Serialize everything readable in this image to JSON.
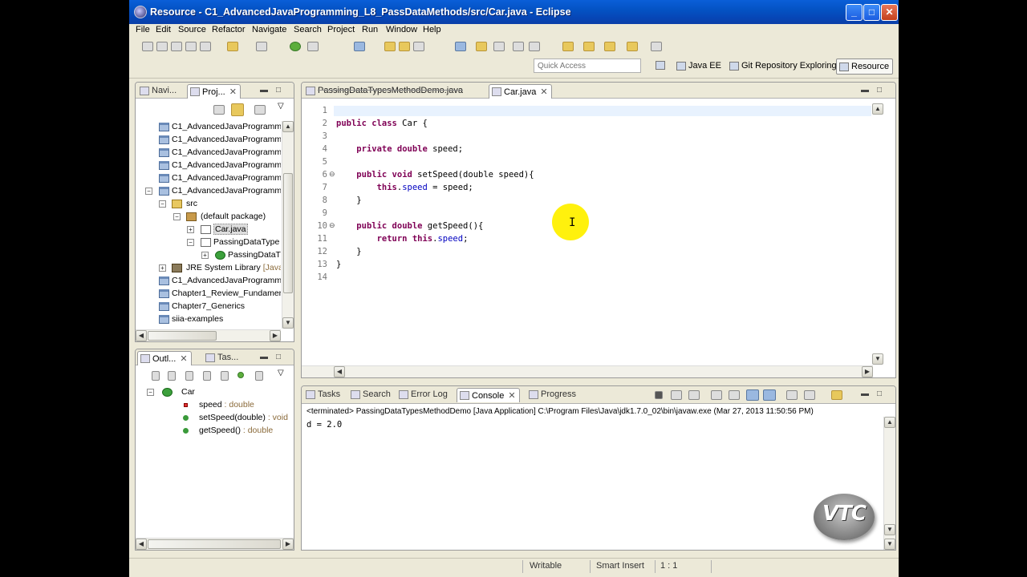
{
  "window": {
    "title": "Resource - C1_AdvancedJavaProgramming_L8_PassDataMethods/src/Car.java - Eclipse",
    "minimize": "_",
    "maximize": "□",
    "close": "✕"
  },
  "menu": [
    "File",
    "Edit",
    "Source",
    "Refactor",
    "Navigate",
    "Search",
    "Project",
    "Run",
    "Window",
    "Help"
  ],
  "toolbar": {
    "quick_access_placeholder": "Quick Access",
    "perspectives": [
      "Java EE",
      "Git Repository Exploring",
      "Resource"
    ],
    "active_perspective": "Resource"
  },
  "navigator": {
    "tabs": [
      "Navi...",
      "Proj...",
      "✕"
    ],
    "tree": [
      {
        "label": "C1_AdvancedJavaProgramm",
        "kind": "project"
      },
      {
        "label": "C1_AdvancedJavaProgramm",
        "kind": "project"
      },
      {
        "label": "C1_AdvancedJavaProgramm",
        "kind": "project"
      },
      {
        "label": "C1_AdvancedJavaProgramm",
        "kind": "project"
      },
      {
        "label": "C1_AdvancedJavaProgramm",
        "kind": "project"
      },
      {
        "label": "C1_AdvancedJavaProgramm",
        "kind": "project",
        "expanded": true
      },
      {
        "label": "src",
        "kind": "src"
      },
      {
        "label": "(default package)",
        "kind": "package"
      },
      {
        "label": "Car.java",
        "kind": "java",
        "selected": true
      },
      {
        "label": "PassingDataType",
        "kind": "java"
      },
      {
        "label": "PassingDataT",
        "kind": "class"
      },
      {
        "label": "JRE System Library",
        "suffix": "[Java",
        "kind": "lib"
      },
      {
        "label": "C1_AdvancedJavaProgramm",
        "kind": "project"
      },
      {
        "label": "Chapter1_Review_Fundamer",
        "kind": "project"
      },
      {
        "label": "Chapter7_Generics",
        "kind": "project"
      },
      {
        "label": "siia-examples",
        "kind": "project"
      }
    ]
  },
  "outline": {
    "tabs": [
      "Outl...",
      "Tas..."
    ],
    "items": [
      {
        "name": "Car",
        "type": ""
      },
      {
        "name": "speed",
        "type": " : double"
      },
      {
        "name": "setSpeed(double)",
        "type": " : void"
      },
      {
        "name": "getSpeed()",
        "type": " : double"
      }
    ]
  },
  "editor": {
    "tabs": [
      {
        "label": "PassingDataTypesMethodDemo.java",
        "active": false
      },
      {
        "label": "Car.java",
        "active": true
      }
    ],
    "line_numbers": [
      "1",
      "2",
      "3",
      "4",
      "5",
      "6",
      "7",
      "8",
      "9",
      "10",
      "11",
      "12",
      "13",
      "14"
    ],
    "lines": {
      "l2": {
        "kw": "public class",
        "rest": " Car {"
      },
      "l4": {
        "kw": "private double",
        "rest": " speed;"
      },
      "l6": {
        "kw": "public void",
        "rest": " setSpeed(double speed){"
      },
      "l6_inner_kw": "double",
      "l7": {
        "kw": "this",
        "field": "speed",
        "rest": " = speed;"
      },
      "l8": "}",
      "l10": {
        "kw": "public double",
        "rest": " getSpeed(){"
      },
      "l11": {
        "kw1": "return",
        "kw2": "this",
        "field": "speed",
        "rest": ";"
      },
      "l12": "}",
      "l13": "}"
    }
  },
  "console": {
    "tabs": [
      "Tasks",
      "Search",
      "Error Log",
      "Console",
      "Progress"
    ],
    "active_tab": "Console",
    "header": "<terminated> PassingDataTypesMethodDemo [Java Application] C:\\Program Files\\Java\\jdk1.7.0_02\\bin\\javaw.exe (Mar 27, 2013 11:50:56 PM)",
    "output": "d = 2.0"
  },
  "status": {
    "writable": "Writable",
    "insert_mode": "Smart Insert",
    "position": "1 : 1"
  },
  "logo": "VTC",
  "colors": {
    "keyword": "#7f0055",
    "field": "#0000c0",
    "title_bar": "#0453c4",
    "highlight": "#fff000"
  }
}
